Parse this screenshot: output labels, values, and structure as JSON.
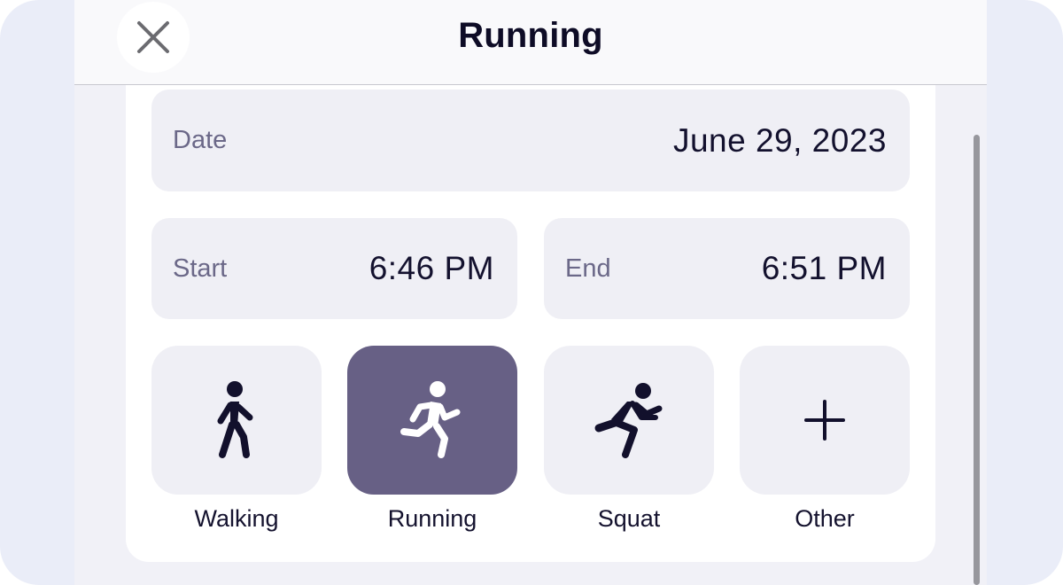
{
  "header": {
    "title": "Running",
    "close_icon": "close-icon"
  },
  "form": {
    "date": {
      "label": "Date",
      "value": "June 29, 2023"
    },
    "start": {
      "label": "Start",
      "value": "6:46 PM"
    },
    "end": {
      "label": "End",
      "value": "6:51 PM"
    }
  },
  "activities": [
    {
      "label": "Walking",
      "icon": "walking-icon",
      "selected": false
    },
    {
      "label": "Running",
      "icon": "running-icon",
      "selected": true
    },
    {
      "label": "Squat",
      "icon": "squat-icon",
      "selected": false
    },
    {
      "label": "Other",
      "icon": "plus-icon",
      "selected": false
    }
  ],
  "colors": {
    "background": "#eaedf8",
    "field_background": "#efeff5",
    "selected_tile": "#676085",
    "text_primary": "#13112e",
    "text_secondary": "#6b6888"
  }
}
